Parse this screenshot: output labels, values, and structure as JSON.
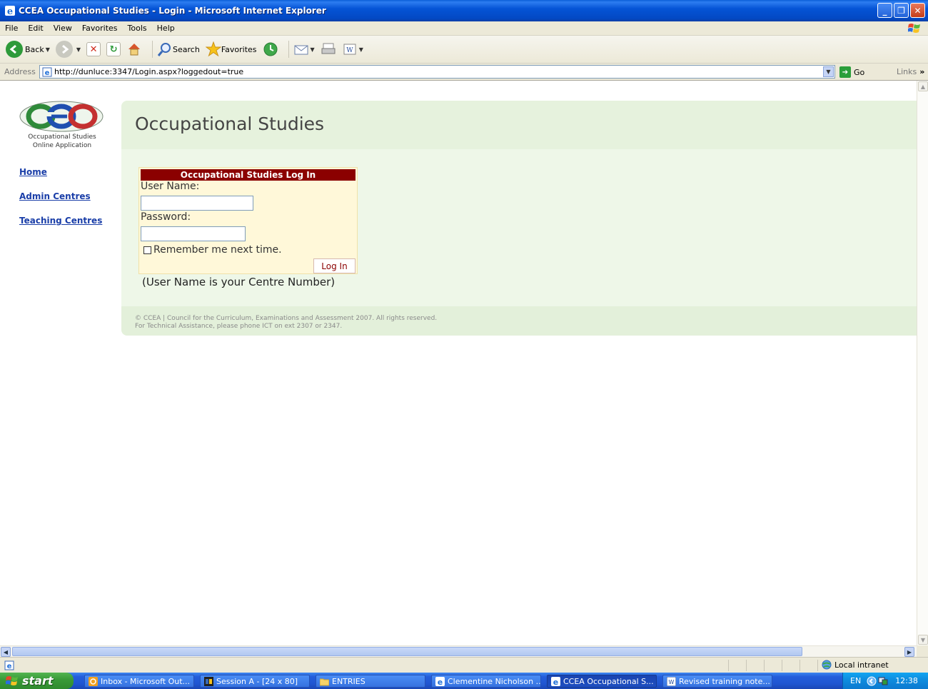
{
  "window": {
    "title": "CCEA Occupational Studies - Login - Microsoft Internet Explorer",
    "controls": [
      "minimize",
      "maximize",
      "close"
    ]
  },
  "menu": [
    "File",
    "Edit",
    "View",
    "Favorites",
    "Tools",
    "Help"
  ],
  "toolbar": {
    "back_label": "Back",
    "search_label": "Search",
    "favorites_label": "Favorites"
  },
  "address": {
    "label": "Address",
    "url": "http://dunluce:3347/Login.aspx?loggedout=true",
    "go_label": "Go",
    "links_label": "Links"
  },
  "page": {
    "logo_text_line1": "Occupational Studies",
    "logo_text_line2": "Online Application",
    "nav": [
      "Home",
      "Admin Centres",
      "Teaching Centres"
    ],
    "heading": "Occupational Studies",
    "login": {
      "title": "Occupational Studies Log In",
      "username_label": "User Name:",
      "username_value": "",
      "password_label": "Password:",
      "password_value": "",
      "remember_label": "Remember me next time.",
      "remember_checked": false,
      "button_label": "Log In"
    },
    "hint": "(User Name is your Centre Number)",
    "footer_line1": "© CCEA | Council for the Curriculum, Examinations and Assessment 2007. All rights reserved.",
    "footer_line2": "For Technical Assistance, please phone ICT on ext 2307 or 2347."
  },
  "statusbar": {
    "zone": "Local intranet"
  },
  "taskbar": {
    "start_label": "start",
    "tasks": [
      {
        "label": "Inbox - Microsoft Out...",
        "icon": "outlook-icon"
      },
      {
        "label": "Session A - [24 x 80]",
        "icon": "terminal-icon"
      },
      {
        "label": "ENTRIES",
        "icon": "folder-icon"
      },
      {
        "label": "Clementine Nicholson ...",
        "icon": "ie-icon"
      },
      {
        "label": "CCEA Occupational S...",
        "icon": "ie-icon",
        "active": true
      },
      {
        "label": "Revised training note...",
        "icon": "word-icon"
      }
    ],
    "lang": "EN",
    "time": "12:38"
  },
  "colors": {
    "header_bg": "#e6f2dd",
    "login_title_bg": "#8b0000",
    "nav_link": "#1a3ea8"
  }
}
